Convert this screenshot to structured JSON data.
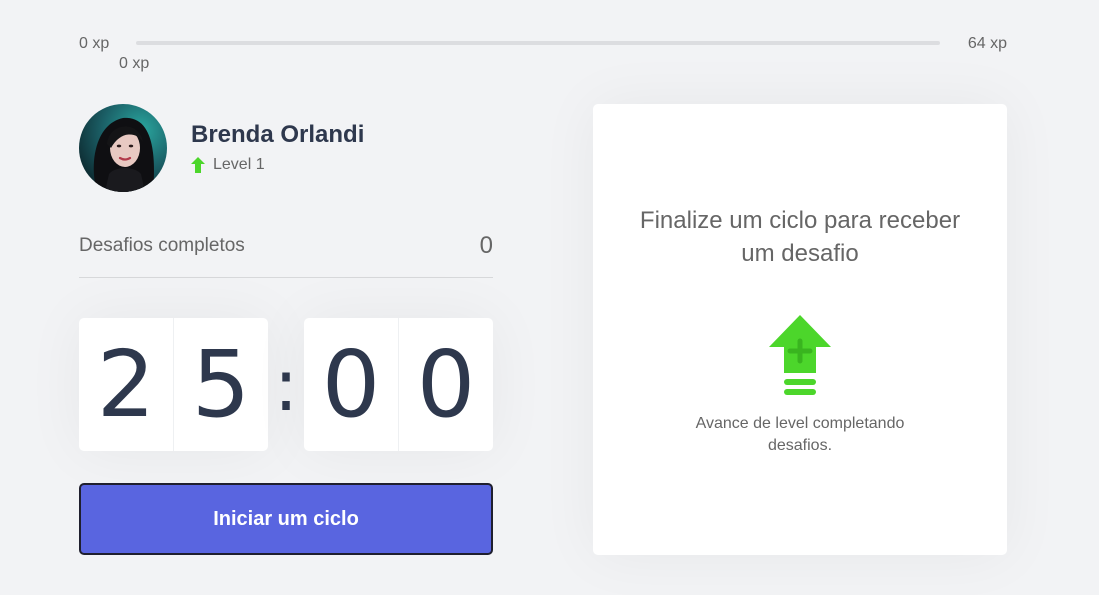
{
  "experience": {
    "min_label": "0 xp",
    "max_label": "64 xp",
    "current_label": "0 xp",
    "progress_fraction": 0.0
  },
  "profile": {
    "name": "Brenda Orlandi",
    "level_label": "Level 1"
  },
  "completed_challenges": {
    "label": "Desafios completos",
    "count": "0"
  },
  "countdown": {
    "minute_left": "2",
    "minute_right": "5",
    "separator": ":",
    "second_left": "0",
    "second_right": "0"
  },
  "start_button": {
    "label": "Iniciar um ciclo",
    "color": "#5965e0"
  },
  "challenge_box": {
    "title": "Finalize um ciclo para receber um desafio",
    "hint": "Avance de level completando desafios.",
    "icon": "level-up-icon",
    "accent_color": "#4cd62b"
  }
}
